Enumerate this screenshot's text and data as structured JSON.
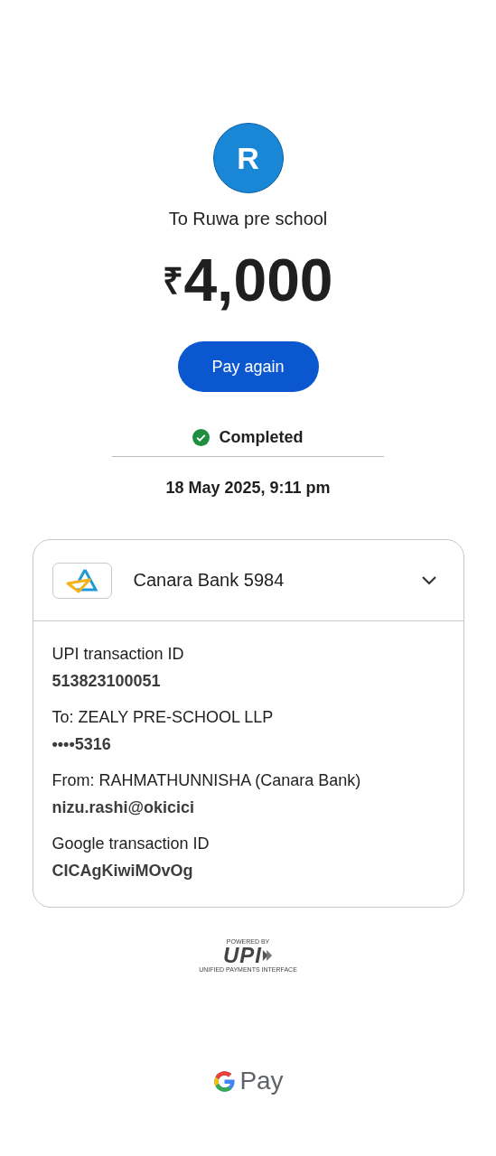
{
  "payee": {
    "initial": "R",
    "title": "To Ruwa pre school"
  },
  "amount": {
    "currency": "₹",
    "value": "4,000"
  },
  "pay_again_button": "Pay again",
  "status": {
    "kind": "success",
    "label": "Completed"
  },
  "date": "18 May 2025, 9:11 pm",
  "account_card": {
    "bank": "Canara Bank 5984",
    "details": [
      {
        "label": "UPI transaction ID",
        "value": "513823100051"
      },
      {
        "label": "To: ZEALY PRE-SCHOOL LLP",
        "value": "••••5316"
      },
      {
        "label": "From: RAHMATHUNNISHA (Canara Bank)",
        "value": "nizu.rashi@okicici"
      },
      {
        "label": "Google transaction ID",
        "value": "CICAgKiwiMOvOg"
      }
    ]
  },
  "upi_logo": {
    "caption": "POWERED BY",
    "mark": "UPI",
    "tagline": "UNIFIED PAYMENTS INTERFACE"
  },
  "gpay_logo": {
    "text": "Pay"
  }
}
